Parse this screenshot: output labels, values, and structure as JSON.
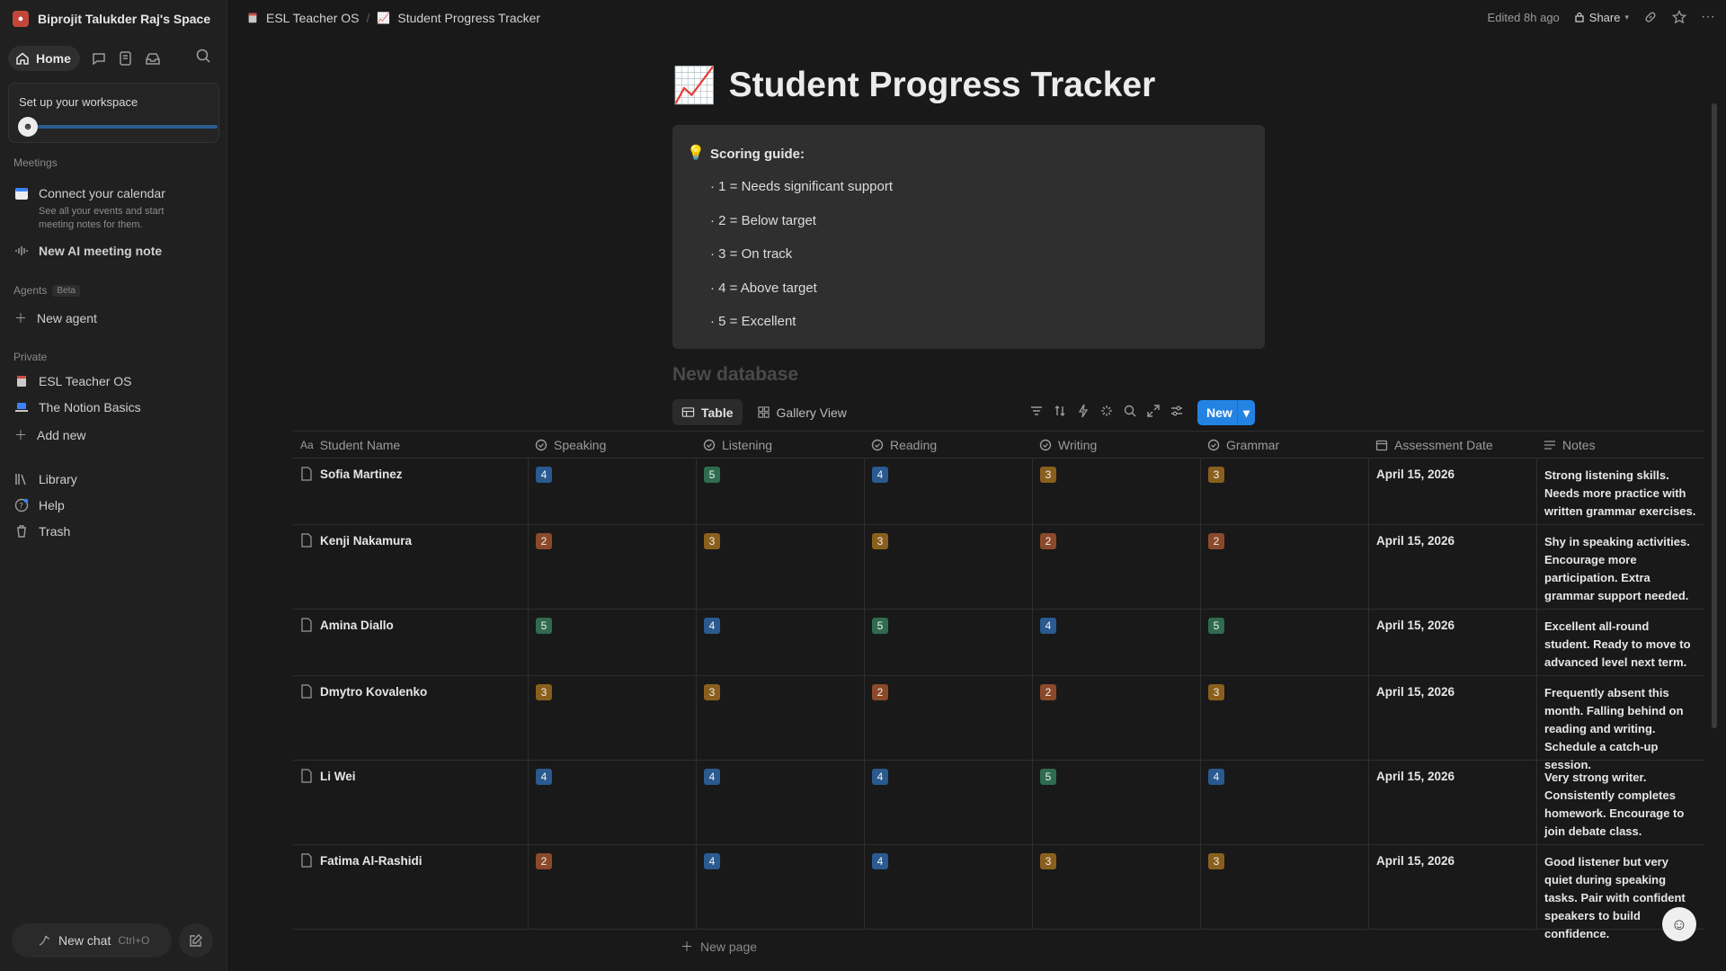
{
  "workspace": {
    "name": "Biprojit Talukder Raj's Space"
  },
  "nav": {
    "home": "Home"
  },
  "setup": {
    "title": "Set up your workspace"
  },
  "meetings": {
    "section": "Meetings",
    "connect_title": "Connect your calendar",
    "connect_sub": "See all your events and start meeting notes for them.",
    "new_note": "New AI meeting note"
  },
  "agents": {
    "section": "Agents",
    "badge": "Beta",
    "new_agent": "New agent"
  },
  "private": {
    "section": "Private",
    "items": [
      {
        "label": "ESL Teacher OS"
      },
      {
        "label": "The Notion Basics"
      }
    ],
    "add_new": "Add new"
  },
  "bottom_nav": {
    "library": "Library",
    "help": "Help",
    "trash": "Trash"
  },
  "new_chat": {
    "label": "New chat",
    "shortcut": "Ctrl+O"
  },
  "breadcrumb": {
    "parent": "ESL Teacher OS",
    "current": "Student Progress Tracker"
  },
  "topbar": {
    "edited": "Edited 8h ago",
    "share": "Share"
  },
  "page": {
    "title": "Student Progress Tracker",
    "emoji": "📈",
    "callout_title": "Scoring guide:",
    "guide": [
      "· 1 = Needs significant support",
      "· 2 = Below target",
      "· 3 = On track",
      "· 4 = Above target",
      "· 5 = Excellent"
    ],
    "database_title": "New database"
  },
  "views": {
    "table": "Table",
    "gallery": "Gallery View"
  },
  "toolbar": {
    "new": "New"
  },
  "table": {
    "columns": [
      "Student Name",
      "Speaking",
      "Listening",
      "Reading",
      "Writing",
      "Grammar",
      "Assessment Date",
      "Notes"
    ],
    "rows": [
      {
        "name": "Sofia Martinez",
        "scores": [
          "4",
          "5",
          "4",
          "3",
          "3"
        ],
        "date": "April 15, 2026",
        "notes": "Strong listening skills. Needs more practice with written grammar exercises."
      },
      {
        "name": "Kenji Nakamura",
        "scores": [
          "2",
          "3",
          "3",
          "2",
          "2"
        ],
        "date": "April 15, 2026",
        "notes": "Shy in speaking activities. Encourage more participation. Extra grammar support needed."
      },
      {
        "name": "Amina Diallo",
        "scores": [
          "5",
          "4",
          "5",
          "4",
          "5"
        ],
        "date": "April 15, 2026",
        "notes": "Excellent all-round student. Ready to move to advanced level next term."
      },
      {
        "name": "Dmytro Kovalenko",
        "scores": [
          "3",
          "3",
          "2",
          "2",
          "3"
        ],
        "date": "April 15, 2026",
        "notes": "Frequently absent this month. Falling behind on reading and writing. Schedule a catch-up session."
      },
      {
        "name": "Li Wei",
        "scores": [
          "4",
          "4",
          "4",
          "5",
          "4"
        ],
        "date": "April 15, 2026",
        "notes": "Very strong writer. Consistently completes homework. Encourage to join debate class."
      },
      {
        "name": "Fatima Al-Rashidi",
        "scores": [
          "2",
          "4",
          "4",
          "3",
          "3"
        ],
        "date": "April 15, 2026",
        "notes": "Good listener but very quiet during speaking tasks. Pair with confident speakers to build confidence."
      }
    ],
    "new_page": "New page"
  },
  "colors": {
    "accent": "#2383e2",
    "score_2": "#8a4a2a",
    "score_3": "#8a5f1d",
    "score_4": "#2a5a8f",
    "score_5": "#2f6b4f"
  }
}
